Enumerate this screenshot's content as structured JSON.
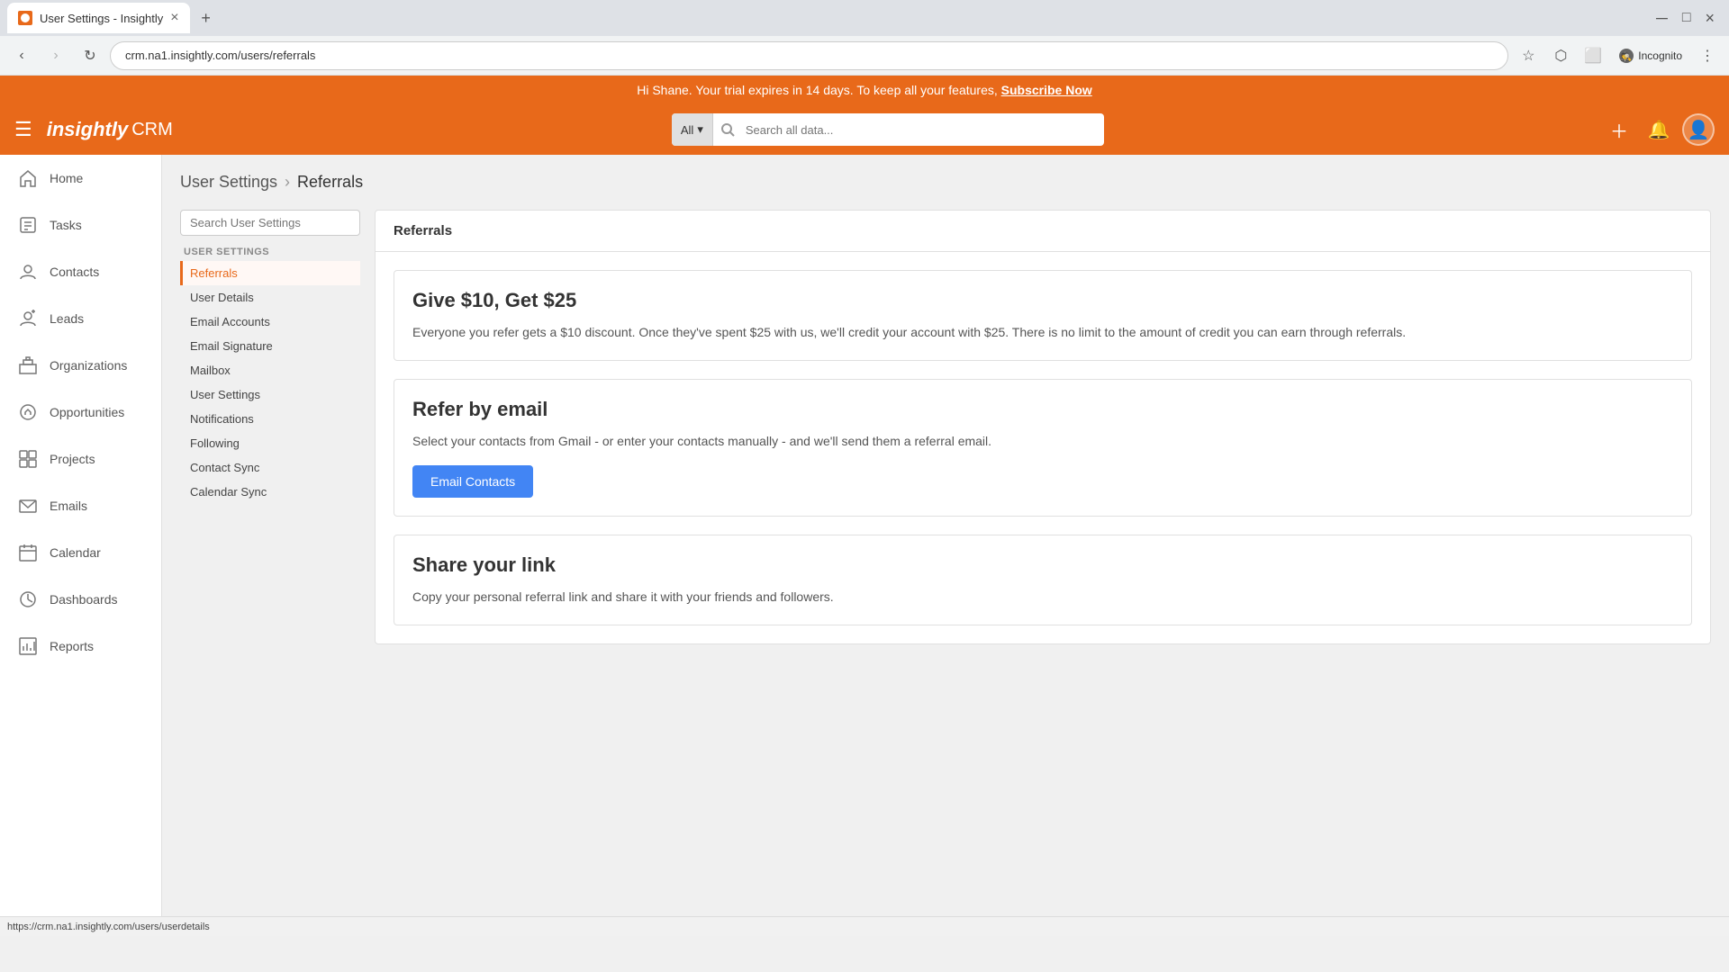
{
  "browser": {
    "tab_title": "User Settings - Insightly",
    "url": "crm.na1.insightly.com/users/referrals",
    "new_tab_label": "+",
    "incognito_label": "Incognito"
  },
  "trial_banner": {
    "text": "Hi Shane. Your trial expires in 14 days. To keep all your features,",
    "cta": "Subscribe Now"
  },
  "header": {
    "logo": "insightly",
    "crm": "CRM",
    "search_placeholder": "Search all data...",
    "search_filter": "All"
  },
  "sidebar": {
    "items": [
      {
        "label": "Home",
        "icon": "home"
      },
      {
        "label": "Tasks",
        "icon": "tasks"
      },
      {
        "label": "Contacts",
        "icon": "contacts"
      },
      {
        "label": "Leads",
        "icon": "leads"
      },
      {
        "label": "Organizations",
        "icon": "organizations"
      },
      {
        "label": "Opportunities",
        "icon": "opportunities"
      },
      {
        "label": "Projects",
        "icon": "projects"
      },
      {
        "label": "Emails",
        "icon": "emails"
      },
      {
        "label": "Calendar",
        "icon": "calendar"
      },
      {
        "label": "Dashboards",
        "icon": "dashboards"
      },
      {
        "label": "Reports",
        "icon": "reports"
      }
    ]
  },
  "breadcrumb": {
    "parent": "User Settings",
    "current": "Referrals",
    "sep": "›"
  },
  "settings_sidebar": {
    "search_placeholder": "Search User Settings",
    "section_label": "USER SETTINGS",
    "nav_items": [
      {
        "label": "Referrals",
        "active": true
      },
      {
        "label": "User Details",
        "active": false
      },
      {
        "label": "Email Accounts",
        "active": false
      },
      {
        "label": "Email Signature",
        "active": false
      },
      {
        "label": "Mailbox",
        "active": false
      },
      {
        "label": "User Settings",
        "active": false
      },
      {
        "label": "Notifications",
        "active": false
      },
      {
        "label": "Following",
        "active": false
      },
      {
        "label": "Contact Sync",
        "active": false
      },
      {
        "label": "Calendar Sync",
        "active": false
      }
    ]
  },
  "content": {
    "panel_title": "Referrals",
    "give_get": {
      "title": "Give $10, Get $25",
      "text": "Everyone you refer gets a $10 discount. Once they've spent $25 with us, we'll credit your account with $25. There is no limit to the amount of credit you can earn through referrals."
    },
    "refer_email": {
      "title": "Refer by email",
      "text": "Select your contacts from Gmail - or enter your contacts manually - and we'll send them a referral email.",
      "button": "Email Contacts"
    },
    "share_link": {
      "title": "Share your link",
      "text": "Copy your personal referral link and share it with your friends and followers."
    }
  },
  "status_bar": {
    "url": "https://crm.na1.insightly.com/users/userdetails"
  }
}
